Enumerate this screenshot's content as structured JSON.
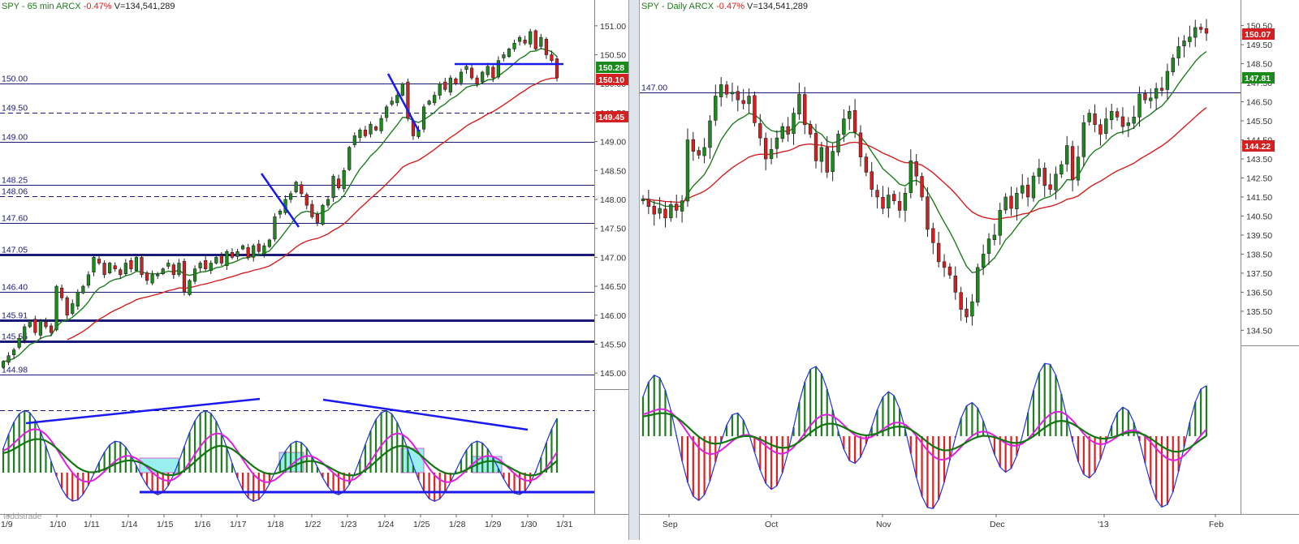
{
  "left": {
    "header": {
      "symbol": "SPY - 65 min",
      "exchange": "ARCX",
      "change": "-0.47%",
      "volume": "V=134,541,289"
    },
    "y_ticks": [
      "151.00",
      "150.50",
      "150.00",
      "149.50",
      "149.00",
      "148.50",
      "148.00",
      "147.50",
      "147.00",
      "146.50",
      "146.00",
      "145.50",
      "145.00"
    ],
    "x_labels": [
      "1/9",
      "1/10",
      "1/11",
      "1/14",
      "1/15",
      "1/16",
      "1/17",
      "1/18",
      "1/22",
      "1/23",
      "1/24",
      "1/25",
      "1/28",
      "1/29",
      "1/30",
      "1/31"
    ],
    "level_labels": [
      "150.00",
      "149.50",
      "149.00",
      "148.25",
      "148.06",
      "147.60",
      "147.05",
      "146.40",
      "145.91",
      "145.55",
      "144.98"
    ],
    "price_badges": [
      {
        "text": "150.28",
        "color": "#1a8a1a"
      },
      {
        "text": "150.10",
        "color": "#d42020"
      },
      {
        "text": "149.45",
        "color": "#d42020"
      }
    ],
    "watermark": "toddstrade"
  },
  "right": {
    "header": {
      "symbol": "SPY - Daily",
      "exchange": "ARCX",
      "change": "-0.47%",
      "volume": "V=134,541,289"
    },
    "y_ticks": [
      "150.50",
      "149.50",
      "148.50",
      "147.50",
      "146.50",
      "145.50",
      "144.50",
      "143.50",
      "142.50",
      "141.50",
      "140.50",
      "139.50",
      "138.50",
      "137.50",
      "136.50",
      "135.50",
      "134.50"
    ],
    "x_labels": [
      "Sep",
      "Oct",
      "Nov",
      "Dec",
      "'13",
      "Feb"
    ],
    "level_labels": [
      "147.00"
    ],
    "price_badges": [
      {
        "text": "150.07",
        "color": "#d42020"
      },
      {
        "text": "147.81",
        "color": "#1a8a1a"
      },
      {
        "text": "144.22",
        "color": "#d42020"
      }
    ]
  },
  "chart_data": [
    {
      "type": "candlestick",
      "timeframe": "65 min",
      "ylim": [
        144.75,
        151.25
      ],
      "horizontal_levels": [
        150.0,
        149.5,
        149.0,
        148.25,
        148.06,
        147.6,
        147.05,
        146.4,
        145.91,
        145.55,
        144.98
      ],
      "closes": [
        145.2,
        145.3,
        145.4,
        145.6,
        145.8,
        145.9,
        145.7,
        145.9,
        145.8,
        145.7,
        146.5,
        146.3,
        146.0,
        146.2,
        146.4,
        146.5,
        146.7,
        147.0,
        146.9,
        146.7,
        146.9,
        146.8,
        146.7,
        146.9,
        146.8,
        147.0,
        146.7,
        146.6,
        146.7,
        146.7,
        146.8,
        146.9,
        146.7,
        146.9,
        146.4,
        146.6,
        146.8,
        146.9,
        146.8,
        146.9,
        147.0,
        146.9,
        147.1,
        147.0,
        147.1,
        147.2,
        147.0,
        147.2,
        147.1,
        147.2,
        147.3,
        147.7,
        147.8,
        148.0,
        148.1,
        148.3,
        148.1,
        147.9,
        147.7,
        147.6,
        147.9,
        148.0,
        148.4,
        148.2,
        148.5,
        148.9,
        149.1,
        149.2,
        149.1,
        149.3,
        149.2,
        149.4,
        149.6,
        149.7,
        149.8,
        150.0,
        149.4,
        149.1,
        149.2,
        149.6,
        149.7,
        149.8,
        150.0,
        149.9,
        150.1,
        150.0,
        150.2,
        150.3,
        150.1,
        150.0,
        150.2,
        150.3,
        150.1,
        150.4,
        150.5,
        150.6,
        150.7,
        150.8,
        150.7,
        150.9,
        150.6,
        150.8,
        150.5,
        150.4,
        150.1
      ],
      "ema_fast_end": 150.28,
      "ema_slow_end": 149.45
    },
    {
      "type": "candlestick",
      "timeframe": "Daily",
      "ylim": [
        133.75,
        151.25
      ],
      "horizontal_levels": [
        147.0
      ],
      "closes": [
        141.4,
        141.0,
        140.6,
        140.9,
        140.4,
        141.1,
        140.8,
        141.3,
        144.5,
        143.9,
        143.7,
        144.1,
        145.5,
        146.8,
        147.4,
        146.9,
        147.0,
        146.6,
        146.4,
        146.8,
        145.4,
        144.6,
        143.5,
        144.0,
        144.6,
        145.2,
        144.8,
        145.9,
        146.9,
        145.3,
        144.8,
        143.4,
        144.1,
        142.8,
        143.9,
        144.8,
        145.6,
        146.0,
        144.9,
        143.6,
        142.8,
        141.9,
        141.5,
        140.9,
        141.6,
        141.3,
        140.8,
        141.7,
        143.4,
        142.6,
        141.5,
        139.8,
        139.1,
        138.1,
        137.8,
        137.4,
        136.5,
        135.6,
        135.2,
        136.0,
        137.8,
        138.5,
        139.3,
        139.5,
        140.8,
        141.5,
        140.9,
        141.7,
        142.1,
        141.5,
        142.6,
        143.0,
        142.1,
        141.9,
        142.7,
        143.2,
        144.2,
        142.4,
        143.6,
        145.4,
        145.9,
        145.3,
        144.8,
        145.6,
        146.0,
        145.7,
        145.2,
        145.4,
        145.7,
        146.9,
        146.6,
        146.7,
        147.2,
        147.1,
        148.1,
        148.8,
        149.4,
        149.7,
        149.9,
        150.4,
        150.3,
        150.1
      ],
      "ema_fast_end": 147.81,
      "ema_slow_end": 144.22
    }
  ]
}
